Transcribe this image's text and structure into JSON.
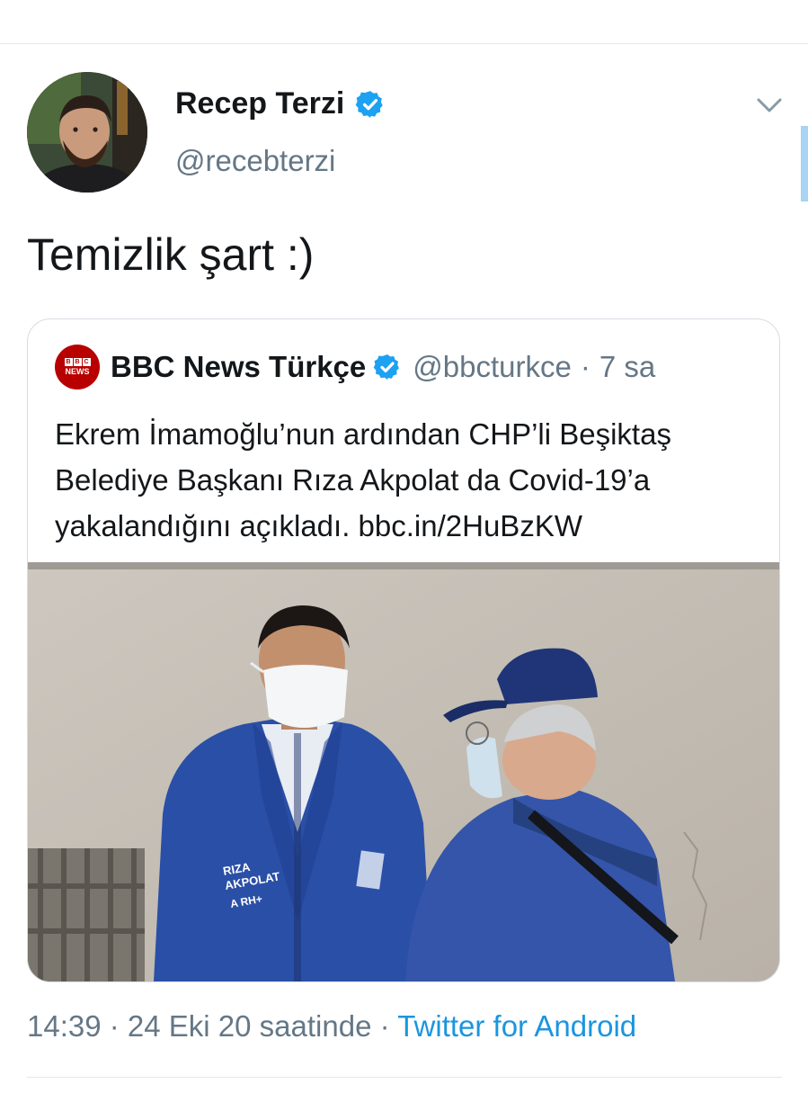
{
  "tweet": {
    "author_name": "Recep Terzi",
    "author_handle": "@recebterzi",
    "verified_icon": "verified-badge-icon",
    "text": "Temizlik şart :)",
    "timestamp": "14:39 · 24 Eki 20 saatinde",
    "meta_separator": "·",
    "source": "Twitter for Android"
  },
  "quoted_tweet": {
    "logo": {
      "letters": [
        "B",
        "B",
        "C"
      ],
      "sub": "NEWS"
    },
    "author_name": "BBC News Türkçe",
    "author_handle": "@bbcturkce",
    "separator": "·",
    "time_ago": "7 sa",
    "text": "Ekrem İmamoğlu’nun ardından CHP’li Beşiktaş Belediye Başkanı Rıza Akpolat da Covid-19’a yakalandığını açıkladı. bbc.in/2HuBzKW",
    "media": {
      "jacket_text_line1": "RIZA",
      "jacket_text_line2": "AKPOLAT",
      "jacket_text_line3": "A RH+"
    }
  },
  "colors": {
    "accent": "#1b95e0",
    "verified": "#1da1f2",
    "secondary_text": "#657786",
    "bbc_red": "#b80000"
  }
}
